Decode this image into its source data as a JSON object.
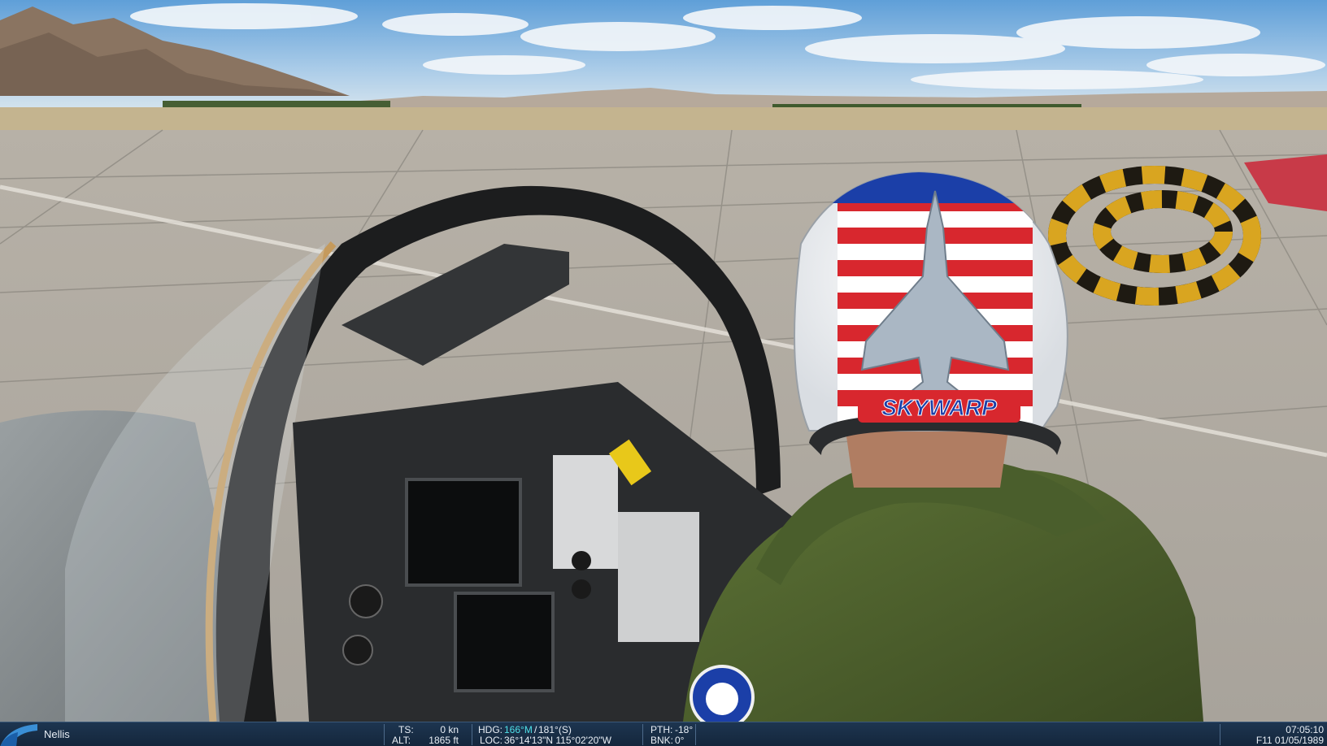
{
  "helmet": {
    "callsign": "SKYWARP"
  },
  "status_bar": {
    "airfield": "Nellis",
    "ts_label": "TS:",
    "ts_value": "0 kn",
    "alt_label": "ALT:",
    "alt_value": "1865 ft",
    "hdg_label": "HDG:",
    "hdg_magnetic": "166°M",
    "hdg_separator": "/",
    "hdg_true": "181°(S)",
    "loc_label": "LOC:",
    "loc_value": "36°14'13\"N 115°02'20\"W",
    "pth_label": "PTH:",
    "pth_value": "-18°",
    "bnk_label": "BNK:",
    "bnk_value": "0°",
    "time": "07:05:10",
    "aircraft_date": "F11 01/05/1989"
  },
  "colors": {
    "status_bar_bg": "#1d3550",
    "status_highlight": "#4fe0e8",
    "flight_suit": "#4a5e2c",
    "helmet_red": "#d8272e",
    "helmet_blue": "#1b3fa8"
  }
}
